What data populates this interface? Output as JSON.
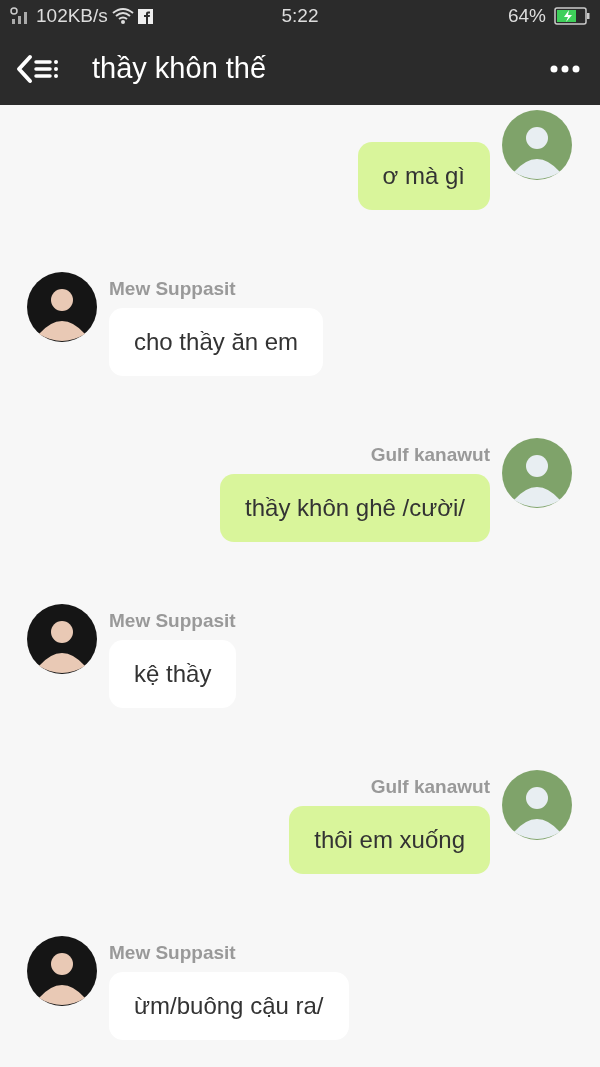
{
  "status_bar": {
    "network_speed": "102KB/s",
    "time": "5:22",
    "battery": "64%"
  },
  "header": {
    "title": "thầy khôn thế"
  },
  "messages": [
    {
      "kind": "sent",
      "text": "ơ mà gì"
    },
    {
      "kind": "received",
      "sender": "Mew Suppasit",
      "text": "cho thầy ăn em"
    },
    {
      "kind": "sent",
      "sender": "Gulf kanawut",
      "text": "thầy khôn ghê /cười/"
    },
    {
      "kind": "received",
      "sender": "Mew Suppasit",
      "text": "kệ thầy"
    },
    {
      "kind": "sent",
      "sender": "Gulf kanawut",
      "text": "thôi em xuống"
    },
    {
      "kind": "received",
      "sender": "Mew Suppasit",
      "text": "ừm/buông cậu ra/"
    }
  ]
}
